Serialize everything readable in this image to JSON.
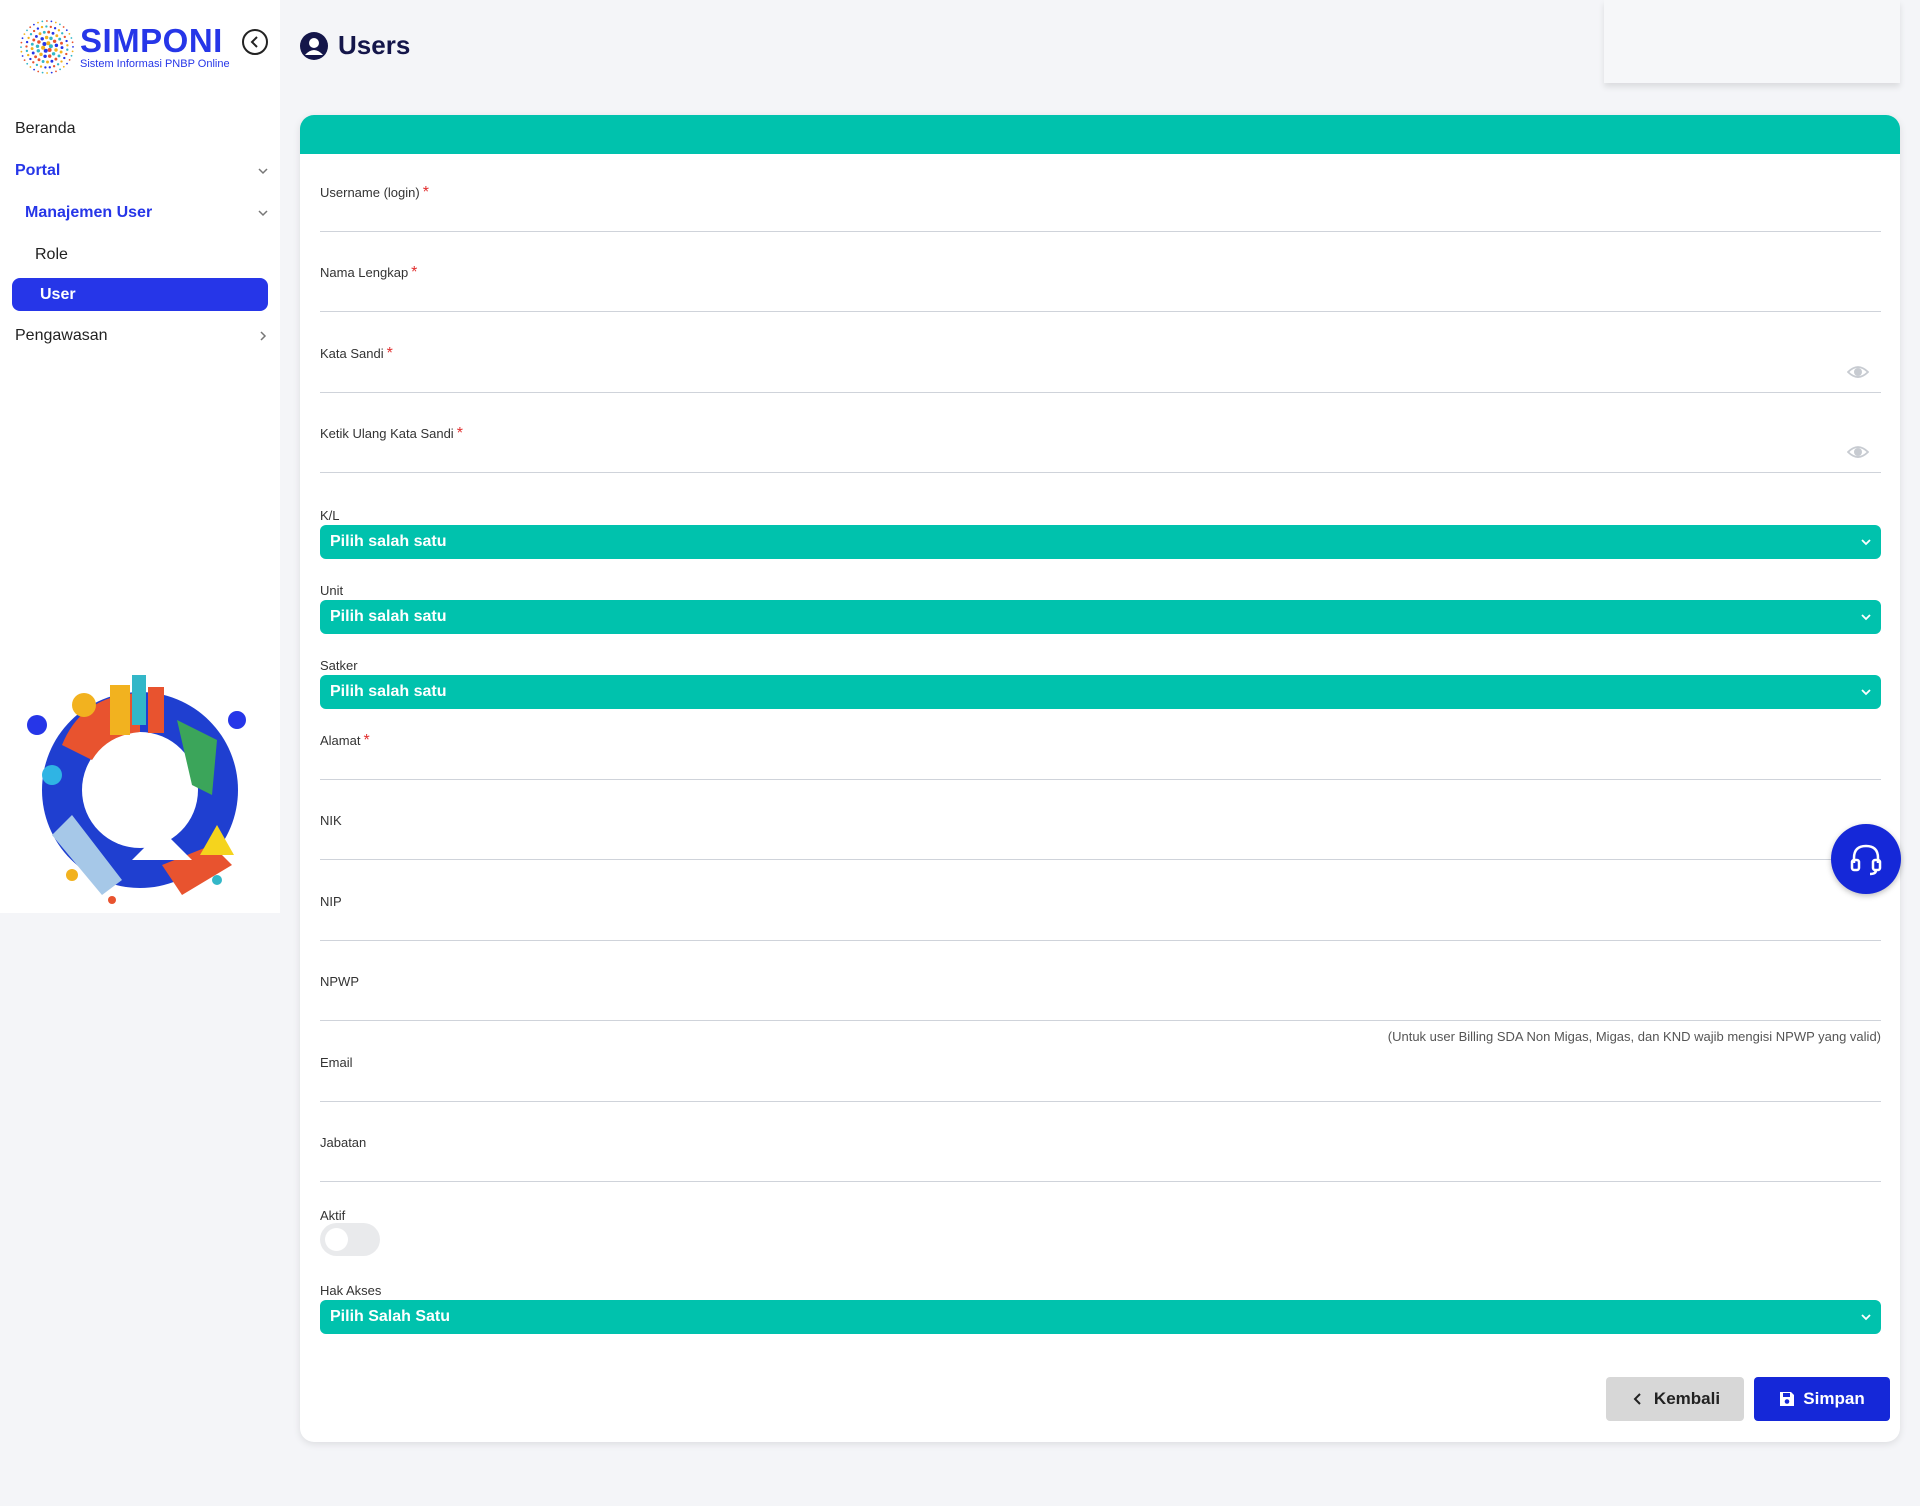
{
  "brand": {
    "name": "SIMPONI",
    "tagline": "Sistem Informasi PNBP Online",
    "color": "#2636e8",
    "teal": "#00c2ad"
  },
  "sidebar": {
    "items": [
      {
        "label": "Beranda"
      },
      {
        "label": "Portal"
      },
      {
        "label": "Manajemen User"
      },
      {
        "label": "Role"
      },
      {
        "label": "User"
      },
      {
        "label": "Pengawasan"
      }
    ]
  },
  "header": {
    "title": "Users",
    "icon": "user-circle-icon"
  },
  "form": {
    "username": {
      "label": "Username (login)",
      "required": "*",
      "value": ""
    },
    "nama": {
      "label": "Nama Lengkap",
      "required": "*",
      "value": ""
    },
    "kata_sandi": {
      "label": "Kata Sandi",
      "required": "*",
      "value": ""
    },
    "ulang_sandi": {
      "label": "Ketik Ulang Kata Sandi",
      "required": "*",
      "value": ""
    },
    "kl": {
      "label": "K/L",
      "selected": "Pilih salah satu"
    },
    "unit": {
      "label": "Unit",
      "selected": "Pilih salah satu"
    },
    "satker": {
      "label": "Satker",
      "selected": "Pilih salah satu"
    },
    "alamat": {
      "label": "Alamat",
      "required": "*",
      "value": ""
    },
    "nik": {
      "label": "NIK",
      "value": ""
    },
    "nip": {
      "label": "NIP",
      "value": ""
    },
    "npwp": {
      "label": "NPWP",
      "value": "",
      "hint": "(Untuk user Billing SDA Non Migas, Migas, dan KND wajib mengisi NPWP yang valid)"
    },
    "email": {
      "label": "Email",
      "value": ""
    },
    "jabatan": {
      "label": "Jabatan",
      "value": ""
    },
    "aktif": {
      "label": "Aktif",
      "on": false
    },
    "hak_akses": {
      "label": "Hak Akses",
      "selected": "Pilih Salah Satu"
    }
  },
  "actions": {
    "back_label": "Kembali",
    "save_label": "Simpan"
  }
}
